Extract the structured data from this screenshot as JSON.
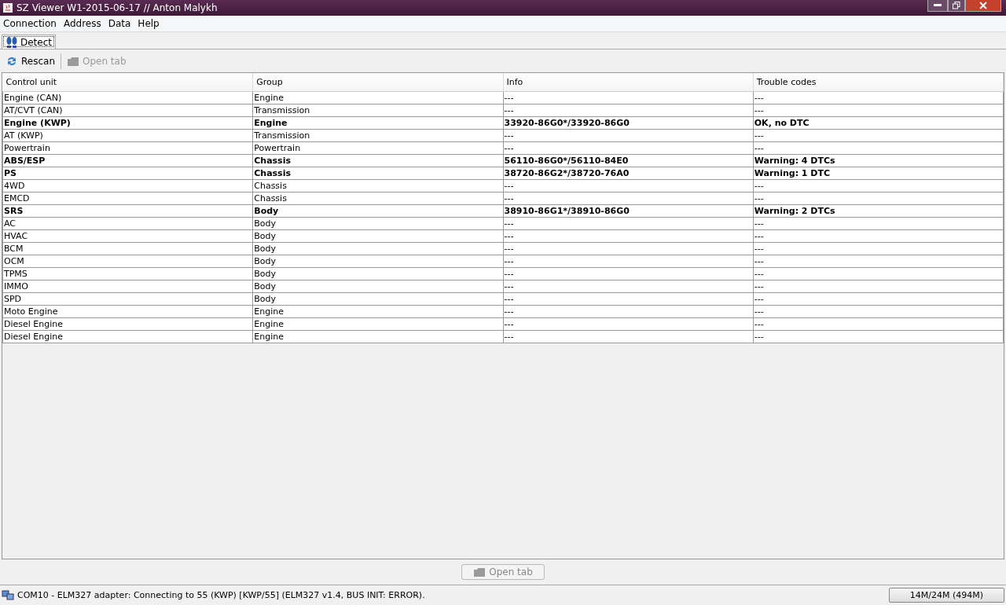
{
  "window": {
    "title": "SZ Viewer W1-2015-06-17 // Anton Malykh"
  },
  "menu": [
    "Connection",
    "Address",
    "Data",
    "Help"
  ],
  "tabs": [
    {
      "label": "Detect",
      "selected": true
    }
  ],
  "toolbar": [
    {
      "label": "Rescan",
      "kind": "rescan",
      "disabled": false
    },
    {
      "label": "Open tab",
      "kind": "open",
      "disabled": true
    }
  ],
  "table": {
    "columns": [
      "Control unit",
      "Group",
      "Info",
      "Trouble codes"
    ],
    "rows": [
      {
        "cells": [
          "Engine (CAN)",
          "Engine",
          "---",
          "---"
        ],
        "detected": false
      },
      {
        "cells": [
          "AT/CVT (CAN)",
          "Transmission",
          "---",
          "---"
        ],
        "detected": false
      },
      {
        "cells": [
          "Engine (KWP)",
          "Engine",
          "33920-86G0*/33920-86G0",
          "OK, no DTC"
        ],
        "detected": true
      },
      {
        "cells": [
          "AT (KWP)",
          "Transmission",
          "---",
          "---"
        ],
        "detected": false
      },
      {
        "cells": [
          "Powertrain",
          "Powertrain",
          "---",
          "---"
        ],
        "detected": false
      },
      {
        "cells": [
          "ABS/ESP",
          "Chassis",
          "56110-86G0*/56110-84E0",
          "Warning: 4 DTCs"
        ],
        "detected": true
      },
      {
        "cells": [
          "PS",
          "Chassis",
          "38720-86G2*/38720-76A0",
          "Warning: 1 DTC"
        ],
        "detected": true
      },
      {
        "cells": [
          "4WD",
          "Chassis",
          "---",
          "---"
        ],
        "detected": false
      },
      {
        "cells": [
          "EMCD",
          "Chassis",
          "---",
          "---"
        ],
        "detected": false
      },
      {
        "cells": [
          "SRS",
          "Body",
          "38910-86G1*/38910-86G0",
          "Warning: 2 DTCs"
        ],
        "detected": true
      },
      {
        "cells": [
          "AC",
          "Body",
          "---",
          "---"
        ],
        "detected": false
      },
      {
        "cells": [
          "HVAC",
          "Body",
          "---",
          "---"
        ],
        "detected": false
      },
      {
        "cells": [
          "BCM",
          "Body",
          "---",
          "---"
        ],
        "detected": false
      },
      {
        "cells": [
          "OCM",
          "Body",
          "---",
          "---"
        ],
        "detected": false
      },
      {
        "cells": [
          "TPMS",
          "Body",
          "---",
          "---"
        ],
        "detected": false
      },
      {
        "cells": [
          "IMMO",
          "Body",
          "---",
          "---"
        ],
        "detected": false
      },
      {
        "cells": [
          "SPD",
          "Body",
          "---",
          "---"
        ],
        "detected": false
      },
      {
        "cells": [
          "Moto Engine",
          "Engine",
          "---",
          "---"
        ],
        "detected": false
      },
      {
        "cells": [
          "Diesel Engine",
          "Engine",
          "---",
          "---"
        ],
        "detected": false
      },
      {
        "cells": [
          "Diesel Engine",
          "Engine",
          "---",
          "---"
        ],
        "detected": false
      }
    ]
  },
  "bottom_button": {
    "label": "Open tab",
    "disabled": true
  },
  "status_bar": {
    "message": "COM10 - ELM327 adapter: Connecting to 55 (KWP) [KWP/55] (ELM327 v1.4, BUS INIT: ERROR).",
    "memory": "14M/24M (494M)"
  }
}
